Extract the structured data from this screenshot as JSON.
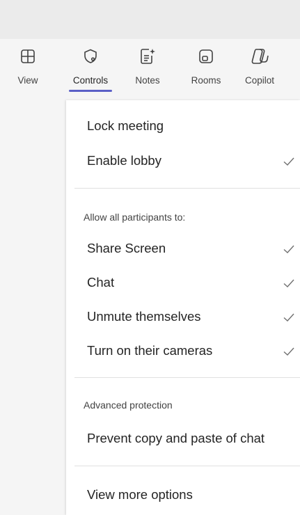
{
  "toolbar": {
    "items": [
      {
        "label": "View",
        "icon": "grid-icon",
        "active": false
      },
      {
        "label": "Controls",
        "icon": "shield-gear-icon",
        "active": true
      },
      {
        "label": "Notes",
        "icon": "notes-sparkle-icon",
        "active": false
      },
      {
        "label": "Rooms",
        "icon": "rooms-icon",
        "active": false
      },
      {
        "label": "Copilot",
        "icon": "copilot-icon",
        "active": false
      }
    ],
    "accent_color": "#5b5fc7"
  },
  "menu": {
    "lock_meeting": {
      "label": "Lock meeting"
    },
    "enable_lobby": {
      "label": "Enable lobby",
      "checked": true
    },
    "participants_section": {
      "title": "Allow all participants to:",
      "items": [
        {
          "label": "Share Screen",
          "checked": true
        },
        {
          "label": "Chat",
          "checked": true
        },
        {
          "label": "Unmute themselves",
          "checked": true
        },
        {
          "label": "Turn on their cameras",
          "checked": true
        }
      ]
    },
    "advanced_section": {
      "title": "Advanced protection",
      "items": [
        {
          "label": "Prevent copy and paste of chat"
        }
      ]
    },
    "more_options": {
      "label": "View more options"
    }
  }
}
